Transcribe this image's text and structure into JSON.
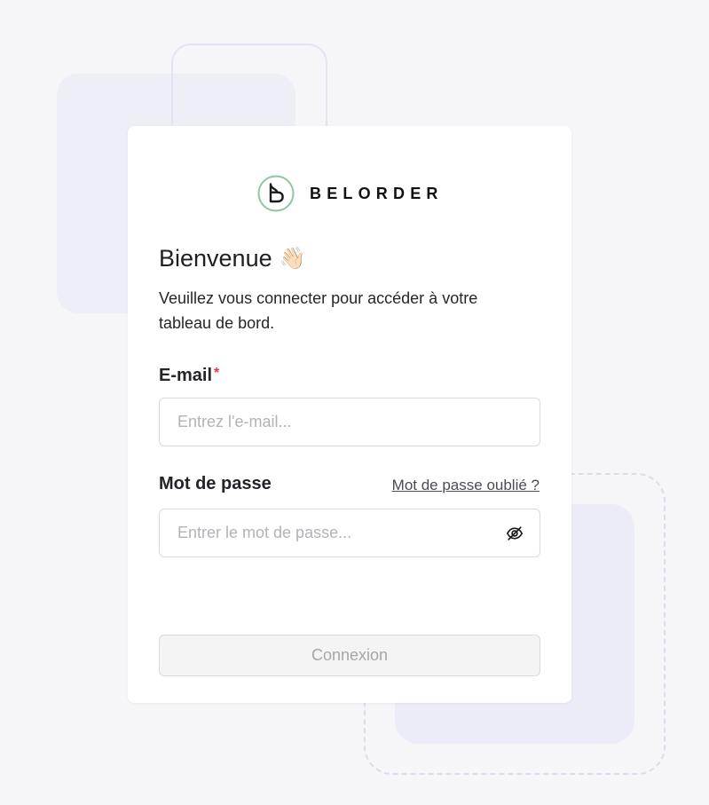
{
  "brand": {
    "name": "BELORDER",
    "logo_icon": "belorder-b-logo-icon",
    "accent_color": "#8dc7a0"
  },
  "login": {
    "title": "Bienvenue",
    "title_icon": "waving-hand-icon",
    "title_emoji": "👋🏻",
    "subtitle": "Veuillez vous connecter pour accéder à votre tableau de bord.",
    "email": {
      "label": "E-mail",
      "required_marker": "*",
      "placeholder": "Entrez l'e-mail...",
      "value": ""
    },
    "password": {
      "label": "Mot de passe",
      "forgot_link": "Mot de passe oublié ?",
      "placeholder": "Entrer le mot de passe...",
      "value": "",
      "toggle_icon": "eye-slash-icon"
    },
    "submit_label": "Connexion",
    "submit_disabled": true
  },
  "colors": {
    "background": "#f6f6f9",
    "required": "#e23b3b",
    "button_disabled_bg": "#f4f4f5",
    "button_disabled_text": "#a6a6ab"
  }
}
